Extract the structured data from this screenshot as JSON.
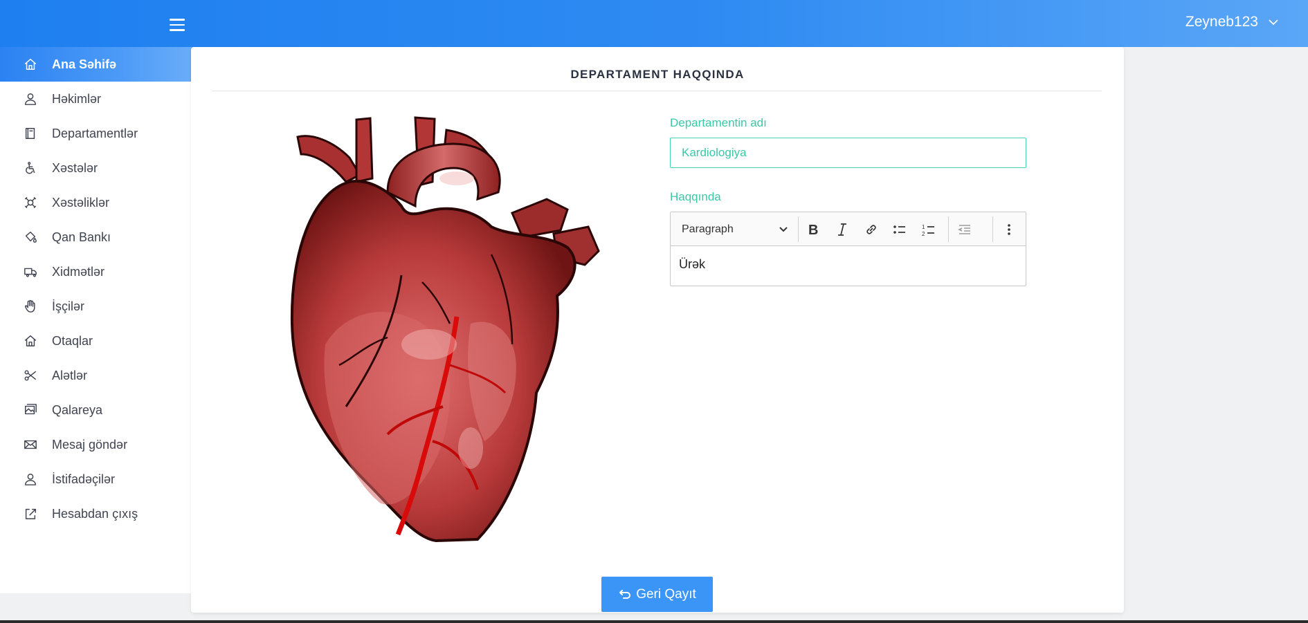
{
  "header": {
    "user_name": "Zeyneb123"
  },
  "sidebar": {
    "items": [
      {
        "label": "Ana Səhifə",
        "icon": "home-icon",
        "active": true
      },
      {
        "label": "Həkimlər",
        "icon": "user-icon",
        "active": false
      },
      {
        "label": "Departamentlər",
        "icon": "book-icon",
        "active": false
      },
      {
        "label": "Xəstələr",
        "icon": "wheelchair-icon",
        "active": false
      },
      {
        "label": "Xəstəliklər",
        "icon": "virus-icon",
        "active": false
      },
      {
        "label": "Qan Bankı",
        "icon": "drop-bucket-icon",
        "active": false
      },
      {
        "label": "Xidmətlər",
        "icon": "truck-icon",
        "active": false
      },
      {
        "label": "İşçilər",
        "icon": "hand-icon",
        "active": false
      },
      {
        "label": "Otaqlar",
        "icon": "house-icon",
        "active": false
      },
      {
        "label": "Alətlər",
        "icon": "scissors-icon",
        "active": false
      },
      {
        "label": "Qalareya",
        "icon": "gallery-icon",
        "active": false
      },
      {
        "label": "Mesaj göndər",
        "icon": "envelope-icon",
        "active": false
      },
      {
        "label": "İstifadəçilər",
        "icon": "user-icon",
        "active": false
      },
      {
        "label": "Hesabdan çıxış",
        "icon": "logout-icon",
        "active": false
      }
    ]
  },
  "card": {
    "title": "DEPARTAMENT HAQQINDA",
    "department_name_label": "Departamentin adı",
    "department_name_value": "Kardiologiya",
    "about_label": "Haqqında",
    "editor": {
      "block_format": "Paragraph",
      "content": "Ürək"
    },
    "back_button_label": "Geri Qayıt"
  },
  "colors": {
    "header_start": "#1e7ff0",
    "header_end": "#5aa6f7",
    "accent_teal": "#39c8a8",
    "button_blue": "#3a95f6"
  }
}
